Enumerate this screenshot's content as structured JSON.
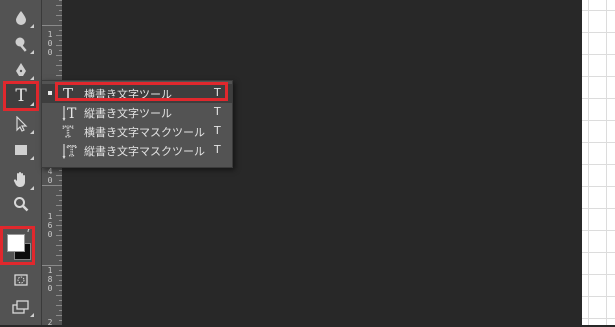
{
  "toolbar": {
    "tools": [
      {
        "name": "blur-tool",
        "icon": "water-drop-icon"
      },
      {
        "name": "dodge-tool",
        "icon": "dodge-icon"
      },
      {
        "name": "pen-tool",
        "icon": "pen-icon"
      },
      {
        "name": "type-tool",
        "icon": "type-icon",
        "label": "T"
      },
      {
        "name": "path-selection-tool",
        "icon": "arrow-icon"
      },
      {
        "name": "rectangle-tool",
        "icon": "rectangle-icon"
      },
      {
        "name": "hand-tool",
        "icon": "hand-icon"
      },
      {
        "name": "zoom-tool",
        "icon": "magnifier-icon"
      },
      {
        "name": "color-swatches",
        "icon": "swatches-icon"
      },
      {
        "name": "quick-mask-mode",
        "icon": "quick-mask-icon"
      },
      {
        "name": "screen-mode",
        "icon": "screen-mode-icon"
      }
    ],
    "accent": "#e0282d"
  },
  "ruler": {
    "labels": [
      "1 0 0",
      "1 2 0",
      "1 4 0",
      "1 6 0",
      "1 8 0",
      "2"
    ]
  },
  "flyout": {
    "items": [
      {
        "label": "横書き文字ツール",
        "shortcut": "T",
        "icon": "horizontal-type-icon",
        "selected": true
      },
      {
        "label": "縦書き文字ツール",
        "shortcut": "T",
        "icon": "vertical-type-icon",
        "selected": false
      },
      {
        "label": "横書き文字マスクツール",
        "shortcut": "T",
        "icon": "horizontal-type-mask-icon",
        "selected": false
      },
      {
        "label": "縦書き文字マスクツール",
        "shortcut": "T",
        "icon": "vertical-type-mask-icon",
        "selected": false
      }
    ]
  }
}
